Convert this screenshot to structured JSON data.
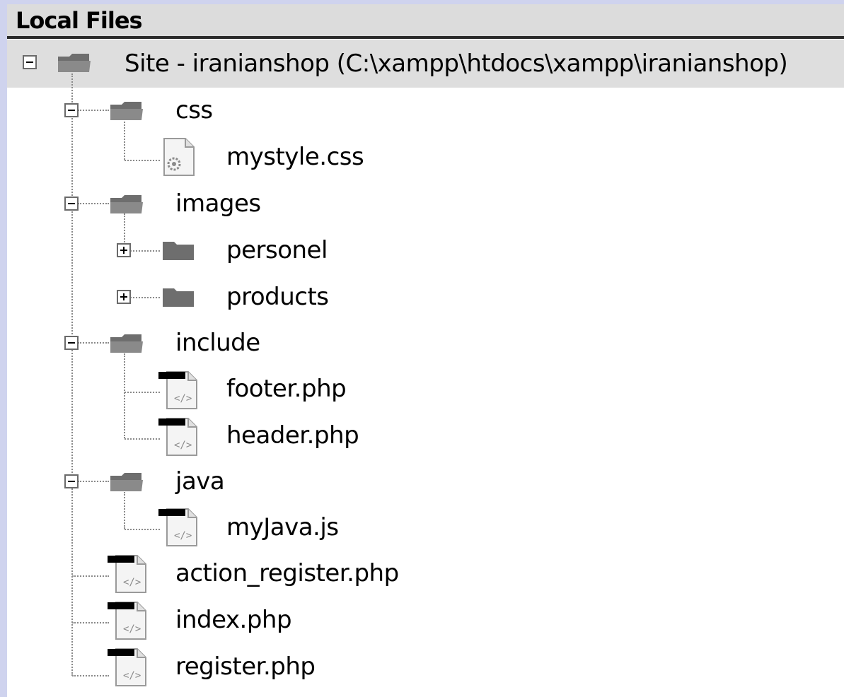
{
  "panel": {
    "title": "Local Files"
  },
  "tree": {
    "root": {
      "label": "Site - iranianshop (C:\\xampp\\htdocs\\xampp\\iranianshop)"
    },
    "css": {
      "label": "css",
      "children": [
        "mystyle.css"
      ]
    },
    "images": {
      "label": "images",
      "children": [
        "personel",
        "products"
      ]
    },
    "include": {
      "label": "include",
      "children": [
        "footer.php",
        "header.php"
      ]
    },
    "java": {
      "label": "java",
      "children": [
        "myJava.js"
      ]
    },
    "files": [
      "action_register.php",
      "index.php",
      "register.php"
    ]
  },
  "icons": {
    "folder": "folder-icon",
    "css_file": "css-file-icon",
    "code_file": "code-file-icon",
    "expand": "plus-icon",
    "collapse": "minus-icon"
  },
  "colors": {
    "header_bg": "#dcdcdc",
    "selected_row_bg": "#dedede",
    "window_edge": "#cfd3ee",
    "folder": "#6e6e6e"
  }
}
